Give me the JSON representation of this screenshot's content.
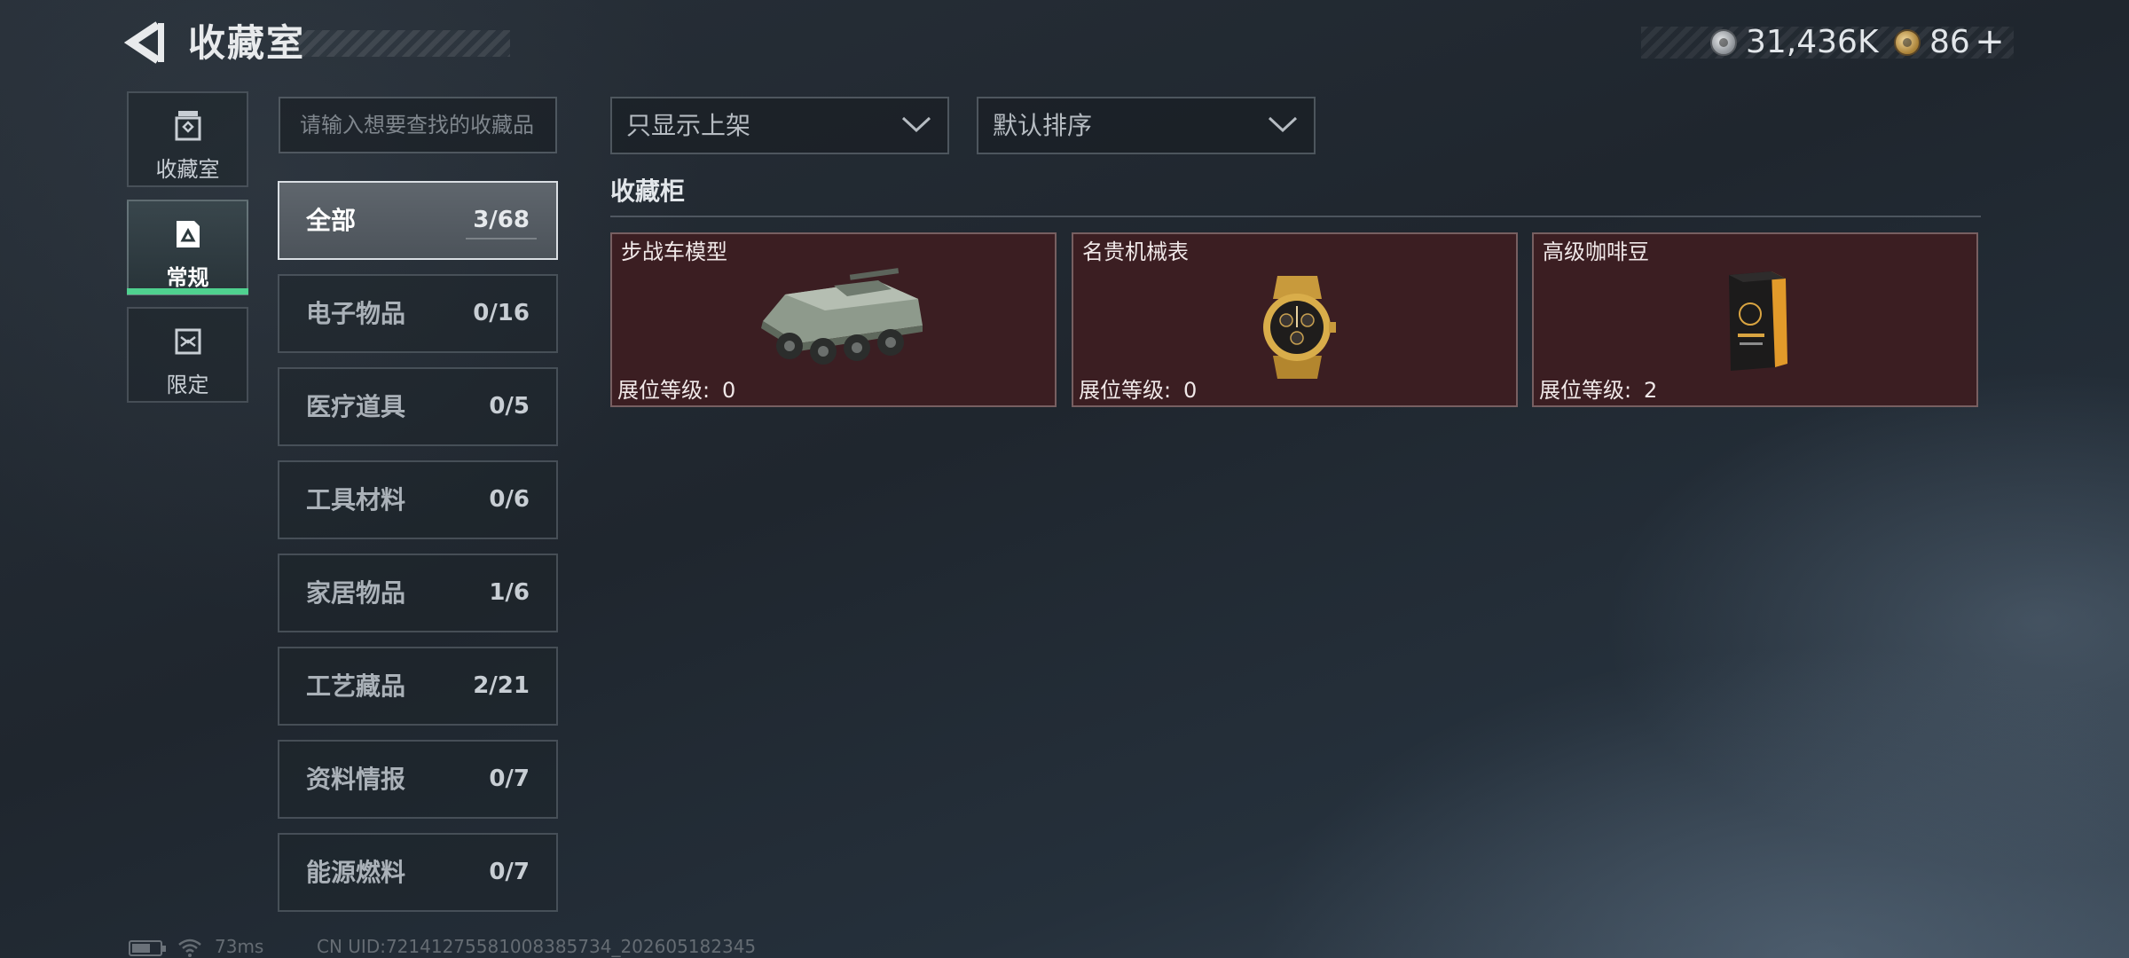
{
  "header": {
    "title": "收藏室",
    "currency_primary": "31,436K",
    "currency_secondary": "86",
    "plus_label": "+"
  },
  "nav": {
    "items": [
      {
        "label": "收藏室",
        "icon": "collection-room-icon"
      },
      {
        "label": "常规",
        "icon": "regular-icon",
        "active": true
      },
      {
        "label": "限定",
        "icon": "limited-icon"
      }
    ],
    "accent_color": "#4fd18f"
  },
  "search": {
    "placeholder": "请输入想要查找的收藏品"
  },
  "categories": [
    {
      "label": "全部",
      "count": "3/68",
      "active": true
    },
    {
      "label": "电子物品",
      "count": "0/16"
    },
    {
      "label": "医疗道具",
      "count": "0/5"
    },
    {
      "label": "工具材料",
      "count": "0/6"
    },
    {
      "label": "家居物品",
      "count": "1/6"
    },
    {
      "label": "工艺藏品",
      "count": "2/21"
    },
    {
      "label": "资料情报",
      "count": "0/7"
    },
    {
      "label": "能源燃料",
      "count": "0/7"
    }
  ],
  "filters": {
    "shelf_filter": "只显示上架",
    "sort": "默认排序"
  },
  "cabinet": {
    "title": "收藏柜",
    "card_color": "#3b1e22",
    "items": [
      {
        "name": "步战车模型",
        "level_label": "展位等级:",
        "level": "0",
        "image": "ifv-model-icon"
      },
      {
        "name": "名贵机械表",
        "level_label": "展位等级:",
        "level": "0",
        "image": "luxury-watch-icon"
      },
      {
        "name": "高级咖啡豆",
        "level_label": "展位等级:",
        "level": "2",
        "image": "coffee-beans-icon"
      }
    ]
  },
  "status": {
    "ping": "73ms",
    "uid": "CN UID:72141275581008385734_202605182345"
  }
}
